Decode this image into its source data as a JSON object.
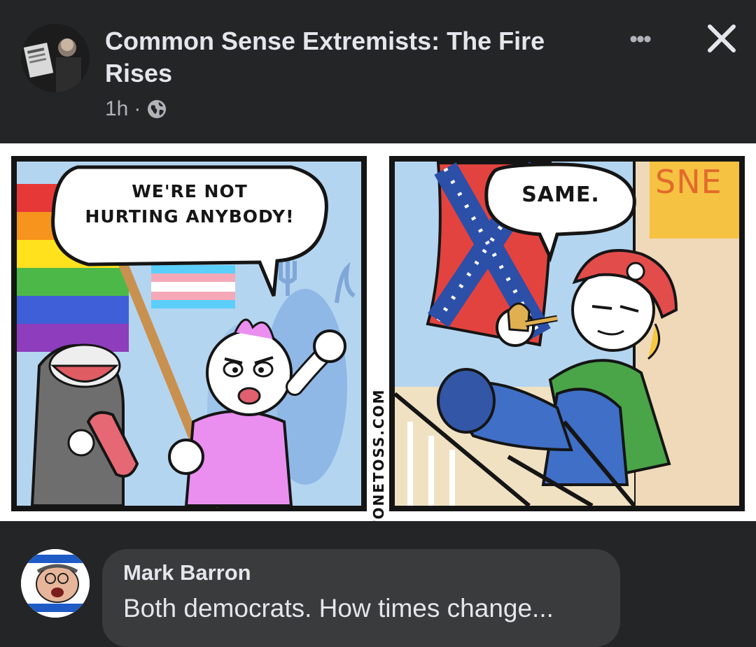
{
  "post": {
    "title": "Common Sense Extremists: The Fire Rises",
    "timestamp": "1h",
    "separator": "·",
    "privacy_icon": "globe-icon",
    "more_icon": "more-horizontal-icon",
    "more_label": "•••",
    "close_icon": "close-icon"
  },
  "comic": {
    "left_panel_speech_line1": "WE'RE NOT",
    "left_panel_speech_line2": "HURTING ANYBODY!",
    "right_panel_speech": "SAME.",
    "watermark": "STONETOSS.COM",
    "sign_text": "SNE"
  },
  "comment": {
    "author": "Mark Barron",
    "text": "Both democrats. How times change..."
  },
  "colors": {
    "background": "#242526",
    "bubble": "#3a3b3c",
    "primary_text": "#e4e6eb",
    "secondary_text": "#b0b3b8"
  }
}
